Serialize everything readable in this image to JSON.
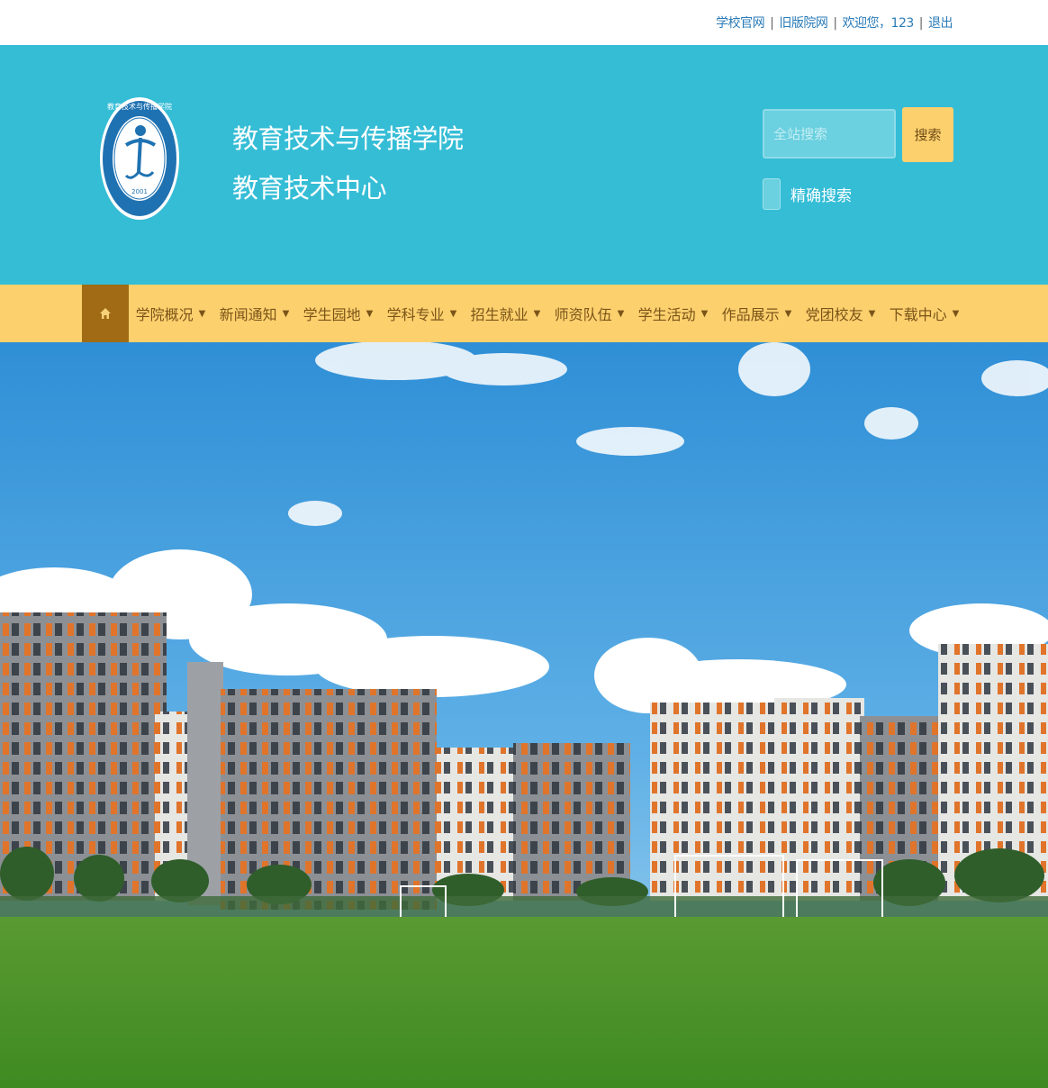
{
  "top_links": {
    "school_site": "学校官网",
    "old_site": "旧版院网",
    "welcome": "欢迎您，123",
    "logout": "退出"
  },
  "header": {
    "title_line1": "教育技术与传播学院",
    "title_line2": "教育技术中心",
    "logo_year": "2001",
    "logo_text": "教育技术与传播学院"
  },
  "search": {
    "placeholder": "全站搜索",
    "button": "搜索",
    "exact_label": "精确搜索"
  },
  "nav": {
    "home_icon": "home-icon",
    "items": [
      {
        "label": "学院概况"
      },
      {
        "label": "新闻通知"
      },
      {
        "label": "学生园地"
      },
      {
        "label": "学科专业"
      },
      {
        "label": "招生就业"
      },
      {
        "label": "师资队伍"
      },
      {
        "label": "学生活动"
      },
      {
        "label": "作品展示"
      },
      {
        "label": "党团校友"
      },
      {
        "label": "下载中心"
      }
    ]
  },
  "colors": {
    "header_bg": "#35bdd6",
    "nav_bg": "#fdd06e",
    "nav_home_bg": "#a06b14",
    "nav_text": "#7a5418",
    "link": "#2a7bb8"
  }
}
